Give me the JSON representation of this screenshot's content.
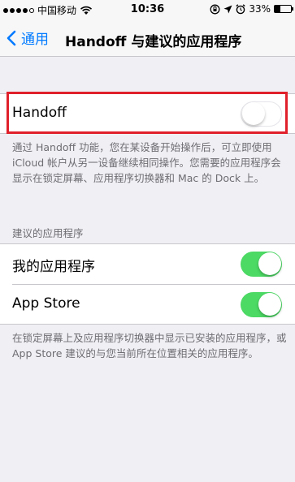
{
  "status_bar": {
    "carrier": "中国移动",
    "time": "10:36",
    "battery_percent": "33%",
    "battery_fraction": 0.33,
    "signal_dots_filled": 4,
    "signal_dots_total": 5,
    "icons": [
      "wifi-icon",
      "rotation-lock-icon",
      "location-icon",
      "alarm-icon"
    ]
  },
  "nav": {
    "back_label": "通用",
    "title": "Handoff 与建议的应用程序"
  },
  "handoff": {
    "label": "Handoff",
    "enabled": false
  },
  "handoff_footer": "通过 Handoff 功能，您在某设备开始操作后，可立即使用 iCloud 帐户从另一设备继续相同操作。您需要的应用程序会显示在锁定屏幕、应用程序切换器和 Mac 的 Dock 上。",
  "suggested": {
    "header": "建议的应用程序",
    "items": [
      {
        "label": "我的应用程序",
        "enabled": true
      },
      {
        "label": "App Store",
        "enabled": true
      }
    ],
    "footer": "在锁定屏幕上及应用程序切换器中显示已安装的应用程序，或 App Store 建议的与您当前所在位置相关的应用程序。"
  },
  "colors": {
    "accent": "#007aff",
    "switch_on": "#4cd964",
    "highlight": "#e0202b",
    "background": "#efeff4"
  }
}
